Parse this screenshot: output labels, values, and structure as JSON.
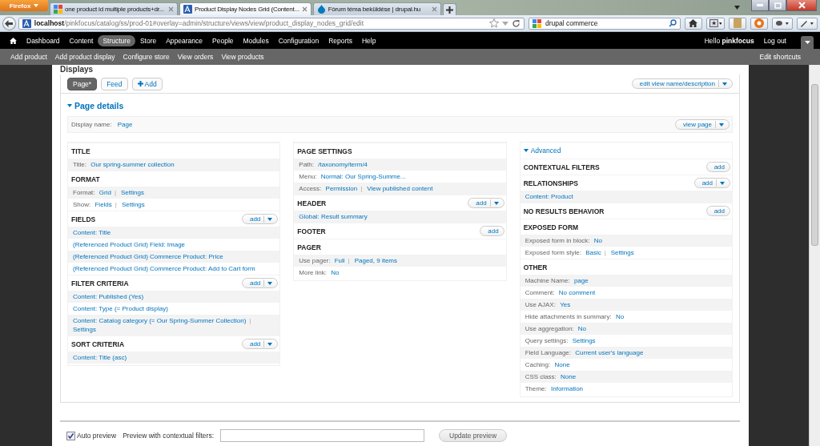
{
  "browser": {
    "app_button": "Firefox",
    "tabs": [
      {
        "title": "one product id multiple products+dr...",
        "selected": false
      },
      {
        "title": "Product Display Nodes Grid (Content...",
        "selected": true
      },
      {
        "title": "Fórum téma beküldése | drupal.hu",
        "selected": false
      }
    ],
    "url_host": "localhost",
    "url_path": "/pinkfocus/catalog/ss/prod-01#overlay=admin/structure/views/view/product_display_nodes_grid/edit",
    "search": "drupal commerce"
  },
  "toolbar": {
    "items": [
      {
        "label": "Dashboard",
        "selected": false
      },
      {
        "label": "Content",
        "selected": false
      },
      {
        "label": "Structure",
        "selected": true
      },
      {
        "label": "Store",
        "selected": false
      },
      {
        "label": "Appearance",
        "selected": false
      },
      {
        "label": "People",
        "selected": false
      },
      {
        "label": "Modules",
        "selected": false
      },
      {
        "label": "Configuration",
        "selected": false
      },
      {
        "label": "Reports",
        "selected": false
      },
      {
        "label": "Help",
        "selected": false
      }
    ],
    "greeting": "Hello",
    "user": "pinkfocus",
    "logout": "Log out"
  },
  "shortcuts": {
    "items": [
      "Add product",
      "Add product display",
      "Configure store",
      "View orders",
      "View products"
    ],
    "edit": "Edit shortcuts"
  },
  "heading": "Displays",
  "display_tabs": [
    {
      "label": "Page*",
      "selected": true,
      "kind": "tab"
    },
    {
      "label": "Feed",
      "selected": false,
      "kind": "tab"
    },
    {
      "label": "Add",
      "kind": "add"
    }
  ],
  "edit_button": "edit view name/description",
  "details_title": "Page details",
  "display_name": {
    "label": "Display name:",
    "value": "Page"
  },
  "view_button": "view page",
  "columns": [
    {
      "sections": [
        {
          "title": "TITLE",
          "rows": [
            {
              "label": "Title:",
              "links": [
                {
                  "text": "Our spring-summer collection"
                }
              ]
            }
          ]
        },
        {
          "title": "FORMAT",
          "rows": [
            {
              "label": "Format:",
              "links": [
                {
                  "text": "Grid",
                  "sep": "|"
                },
                {
                  "text": "Settings"
                }
              ]
            },
            {
              "label": "Show:",
              "links": [
                {
                  "text": "Fields",
                  "sep": "|"
                },
                {
                  "text": "Settings"
                }
              ]
            }
          ]
        },
        {
          "title": "FIELDS",
          "add": {
            "label": "add",
            "dropdown": true
          },
          "rows": [
            {
              "links": [
                {
                  "text": "Content: Title"
                }
              ]
            },
            {
              "links": [
                {
                  "text": "(Referenced Product Grid) Field: Image"
                }
              ]
            },
            {
              "links": [
                {
                  "text": "(Referenced Product Grid) Commerce Product: Price"
                }
              ]
            },
            {
              "links": [
                {
                  "text": "(Referenced Product Grid) Commerce Product: Add to Cart form"
                }
              ]
            }
          ]
        },
        {
          "title": "FILTER CRITERIA",
          "add": {
            "label": "add",
            "dropdown": true
          },
          "rows": [
            {
              "links": [
                {
                  "text": "Content: Published (Yes)"
                }
              ]
            },
            {
              "links": [
                {
                  "text": "Content: Type (= Product display)"
                }
              ]
            },
            {
              "links": [
                {
                  "text": "Content: Catalog category (= Our Spring-Summer Collection)",
                  "sep": "|"
                },
                {
                  "text": "Settings"
                }
              ]
            }
          ]
        },
        {
          "title": "SORT CRITERIA",
          "add": {
            "label": "add",
            "dropdown": true
          },
          "rows": [
            {
              "links": [
                {
                  "text": "Content: Title (asc)"
                }
              ]
            }
          ]
        }
      ]
    },
    {
      "sections": [
        {
          "title": "PAGE SETTINGS",
          "rows": [
            {
              "label": "Path:",
              "links": [
                {
                  "text": "/taxonomy/term/4"
                }
              ]
            },
            {
              "label": "Menu:",
              "links": [
                {
                  "text": "Normal: Our Spring-Summe..."
                }
              ]
            },
            {
              "label": "Access:",
              "links": [
                {
                  "text": "Permission",
                  "sep": "|"
                },
                {
                  "text": "View published content"
                }
              ]
            }
          ]
        },
        {
          "title": "HEADER",
          "add": {
            "label": "add",
            "dropdown": true
          },
          "rows": [
            {
              "links": [
                {
                  "text": "Global: Result summary"
                }
              ]
            }
          ]
        },
        {
          "title": "FOOTER",
          "add": {
            "label": "add",
            "dropdown": false
          }
        },
        {
          "title": "PAGER",
          "rows": [
            {
              "label": "Use pager:",
              "links": [
                {
                  "text": "Full",
                  "sep": "|"
                },
                {
                  "text": "Paged, 9 items"
                }
              ]
            },
            {
              "label": "More link:",
              "links": [
                {
                  "text": "No"
                }
              ]
            }
          ]
        }
      ]
    },
    {
      "advanced": "Advanced",
      "sections": [
        {
          "title": "CONTEXTUAL FILTERS",
          "add": {
            "label": "add",
            "dropdown": false
          }
        },
        {
          "title": "RELATIONSHIPS",
          "add": {
            "label": "add",
            "dropdown": true
          },
          "rows": [
            {
              "links": [
                {
                  "text": "Content: Product"
                }
              ]
            }
          ]
        },
        {
          "title": "NO RESULTS BEHAVIOR",
          "add": {
            "label": "add",
            "dropdown": false
          }
        },
        {
          "title": "EXPOSED FORM",
          "rows": [
            {
              "label": "Exposed form in block:",
              "links": [
                {
                  "text": "No"
                }
              ]
            },
            {
              "label": "Exposed form style:",
              "links": [
                {
                  "text": "Basic",
                  "sep": "|"
                },
                {
                  "text": "Settings"
                }
              ]
            }
          ]
        },
        {
          "title": "OTHER",
          "rows": [
            {
              "label": "Machine Name:",
              "links": [
                {
                  "text": "page"
                }
              ]
            },
            {
              "label": "Comment:",
              "links": [
                {
                  "text": "No comment"
                }
              ]
            },
            {
              "label": "Use AJAX:",
              "links": [
                {
                  "text": "Yes"
                }
              ]
            },
            {
              "label": "Hide attachments in summary:",
              "links": [
                {
                  "text": "No"
                }
              ]
            },
            {
              "label": "Use aggregation:",
              "links": [
                {
                  "text": "No"
                }
              ]
            },
            {
              "label": "Query settings:",
              "links": [
                {
                  "text": "Settings"
                }
              ]
            },
            {
              "label": "Field Language:",
              "links": [
                {
                  "text": "Current user's language"
                }
              ]
            },
            {
              "label": "Caching:",
              "links": [
                {
                  "text": "None"
                }
              ]
            },
            {
              "label": "CSS class:",
              "links": [
                {
                  "text": "None"
                }
              ]
            },
            {
              "label": "Theme:",
              "links": [
                {
                  "text": "Information"
                }
              ]
            }
          ]
        }
      ]
    }
  ],
  "preview": {
    "auto": {
      "label": "Auto preview",
      "checked": true
    },
    "filters_label": "Preview with contextual filters:",
    "button": "Update preview"
  }
}
